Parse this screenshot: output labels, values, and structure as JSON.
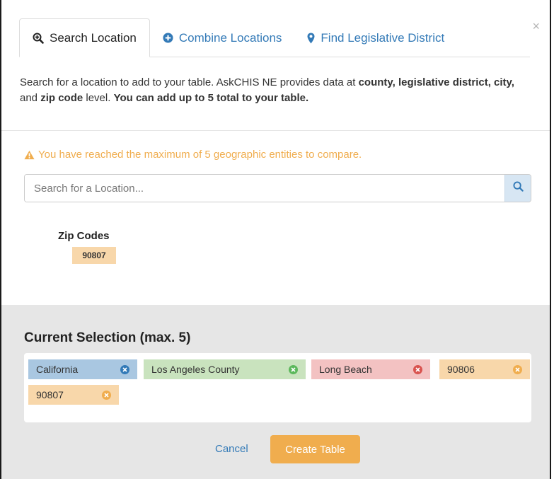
{
  "modal": {
    "close_label": "×"
  },
  "tabs": [
    {
      "label": "Search Location",
      "icon": "search-plus-icon",
      "active": true
    },
    {
      "label": "Combine Locations",
      "icon": "plus-circle-icon",
      "active": false
    },
    {
      "label": "Find Legislative District",
      "icon": "map-marker-icon",
      "active": false
    }
  ],
  "description": {
    "part1": "Search for a location to add to your table. AskCHIS NE provides data at ",
    "bold1": "county, legislative district, city,",
    "part2": " and ",
    "bold2": "zip code",
    "part3": " level. ",
    "bold3": "You can add up to 5 total to your table."
  },
  "warning": {
    "icon": "warning-icon",
    "text": "You have reached the maximum of 5 geographic entities to compare."
  },
  "search": {
    "placeholder": "Search for a Location...",
    "value": "",
    "button_icon": "search-icon"
  },
  "results": {
    "heading": "Zip Codes",
    "items": [
      "90807"
    ]
  },
  "current_selection": {
    "title": "Current Selection (max. 5)",
    "items": [
      {
        "label": "California",
        "color": "#a9c7e1"
      },
      {
        "label": "Los Angeles County",
        "color": "#c9e3be"
      },
      {
        "label": "Long Beach",
        "color": "#f3c2c2"
      },
      {
        "label": "90806",
        "color": "#f8d7aa"
      },
      {
        "label": "90807",
        "color": "#f8d7aa"
      }
    ]
  },
  "actions": {
    "cancel_label": "Cancel",
    "create_label": "Create Table"
  },
  "colors": {
    "link": "#337ab7",
    "warning": "#f0ad4e",
    "primary_button": "#f0ad4e"
  }
}
